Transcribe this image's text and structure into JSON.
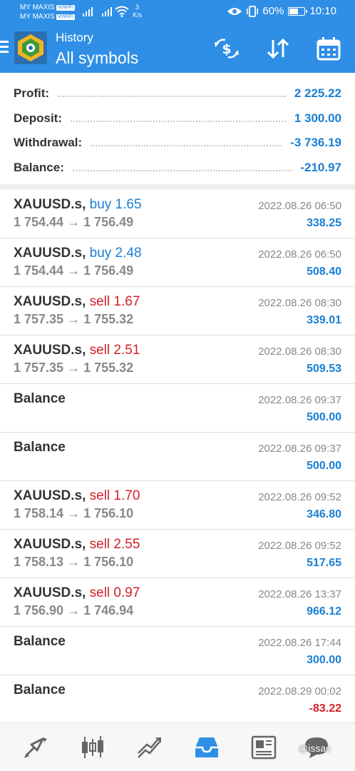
{
  "status_bar": {
    "carrier_1": "MY MAXIS",
    "carrier_2": "MY MAXIS",
    "wifi_tag": "VoWiFi",
    "speed_value": "3",
    "speed_unit": "K/s",
    "battery": "60%",
    "battery_level": 0.6,
    "time": "10:10"
  },
  "app_bar": {
    "subtitle": "History",
    "title": "All symbols",
    "icons": [
      "menu-icon",
      "app-logo",
      "currency-exchange-icon",
      "sort-icon",
      "calendar-icon"
    ]
  },
  "summary": {
    "profit_label": "Profit:",
    "profit_value": "2 225.22",
    "deposit_label": "Deposit:",
    "deposit_value": "1 300.00",
    "withdrawal_label": "Withdrawal:",
    "withdrawal_value": "-3 736.19",
    "balance_label": "Balance:",
    "balance_value": "-210.97"
  },
  "deals": [
    {
      "symbol": "XAUUSD.s,",
      "side": "buy 1.65",
      "prices": "1 754.44 → 1 756.49",
      "time": "2022.08.26 06:50",
      "profit": "338.25"
    },
    {
      "symbol": "XAUUSD.s,",
      "side": "buy 2.48",
      "prices": "1 754.44 → 1 756.49",
      "time": "2022.08.26 06:50",
      "profit": "508.40"
    },
    {
      "symbol": "XAUUSD.s,",
      "side": "sell 1.67",
      "prices": "1 757.35 → 1 755.32",
      "time": "2022.08.26 08:30",
      "profit": "339.01"
    },
    {
      "symbol": "XAUUSD.s,",
      "side": "sell 2.51",
      "prices": "1 757.35 → 1 755.32",
      "time": "2022.08.26 08:30",
      "profit": "509.53"
    },
    {
      "symbol": "Balance",
      "side": "",
      "prices": "",
      "time": "2022.08.26 09:37",
      "profit": "500.00"
    },
    {
      "symbol": "Balance",
      "side": "",
      "prices": "",
      "time": "2022.08.26 09:37",
      "profit": "500.00"
    },
    {
      "symbol": "XAUUSD.s,",
      "side": "sell 1.70",
      "prices": "1 758.14 → 1 756.10",
      "time": "2022.08.26 09:52",
      "profit": "346.80"
    },
    {
      "symbol": "XAUUSD.s,",
      "side": "sell 2.55",
      "prices": "1 758.13 → 1 756.10",
      "time": "2022.08.26 09:52",
      "profit": "517.65"
    },
    {
      "symbol": "XAUUSD.s,",
      "side": "sell 0.97",
      "prices": "1 756.90 → 1 746.94",
      "time": "2022.08.26 13:37",
      "profit": "966.12"
    },
    {
      "symbol": "Balance",
      "side": "",
      "prices": "",
      "time": "2022.08.26 17:44",
      "profit": "300.00"
    },
    {
      "symbol": "Balance",
      "side": "",
      "prices": "",
      "time": "2022.08.29 00:02",
      "profit": "-83.22"
    }
  ],
  "bottom_nav": {
    "items": [
      "quotes-icon",
      "chart-icon",
      "trade-icon",
      "history-icon",
      "news-icon",
      "chat-icon"
    ],
    "active": "history-icon",
    "watermark": "@issac"
  },
  "colors": {
    "accent": "#2f8fe6",
    "positive": "#1a7fd4",
    "negative": "#d4202a",
    "buy": "#1a7fd4",
    "sell": "#d4202a"
  }
}
